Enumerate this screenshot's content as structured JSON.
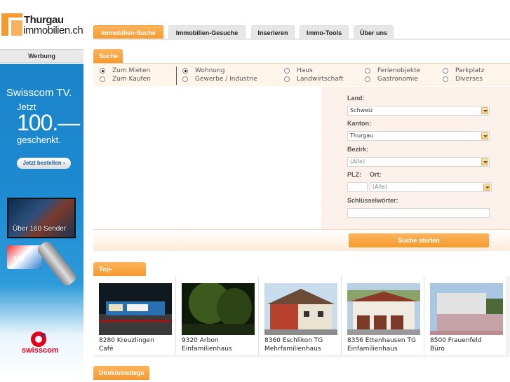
{
  "logo": {
    "line1": "Thurgau",
    "line2": "immobilien.ch",
    "accent": "#f59a2d"
  },
  "ad": {
    "label": "Werbung",
    "tv": "Swisscom TV.",
    "jetzt": "Jetzt",
    "amount": "100.—",
    "geschenkt": "geschenkt.",
    "button": "Jetzt bestellen ›",
    "sender": "Über 160 Sender",
    "card": "100",
    "brand": "swisscom"
  },
  "nav": {
    "tabs": [
      {
        "label": "Immobilien-Suche",
        "active": true
      },
      {
        "label": "Immobilien-Gesuche",
        "active": false
      },
      {
        "label": "Inserieren",
        "active": false
      },
      {
        "label": "Immo-Tools",
        "active": false
      },
      {
        "label": "Über uns",
        "active": false
      }
    ]
  },
  "search": {
    "header": "Suche",
    "mode": [
      {
        "label": "Zum Mieten",
        "checked": true
      },
      {
        "label": "Zum Kaufen",
        "checked": false
      }
    ],
    "categories": [
      {
        "label": "Wohnung",
        "checked": true
      },
      {
        "label": "Gewerbe / Industrie",
        "checked": false
      },
      {
        "label": "Haus",
        "checked": false
      },
      {
        "label": "Landwirtschaft",
        "checked": false
      },
      {
        "label": "Ferienobjekte",
        "checked": false
      },
      {
        "label": "Gastronomie",
        "checked": false
      },
      {
        "label": "Parkplatz",
        "checked": false
      },
      {
        "label": "Diverses",
        "checked": false
      }
    ],
    "land_label": "Land:",
    "land_value": "Schweiz",
    "kanton_label": "Kanton:",
    "kanton_value": "Thurgau",
    "bezirk_label": "Bezirk:",
    "bezirk_value": "(Alle)",
    "plz_label": "PLZ:",
    "ort_label": "Ort:",
    "ort_value": "(Alle)",
    "plz_value": "",
    "keywords_label": "Schlüsselwörter:",
    "keywords_value": "",
    "submit": "Suche starten"
  },
  "top_offers": {
    "header": "Top-Angebote",
    "items": [
      {
        "location": "8280 Kreuzlingen",
        "type": "Café"
      },
      {
        "location": "9320 Arbon",
        "type": "Einfamilienhaus"
      },
      {
        "location": "8360 Eschlikon TG",
        "type": "Mehrfamilienhaus"
      },
      {
        "location": "8356 Ettenhausen TG",
        "type": "Einfamilienhaus"
      },
      {
        "location": "8500 Frauenfeld",
        "type": "Büro"
      }
    ]
  },
  "direct": {
    "header": "Direkteinstiege"
  }
}
